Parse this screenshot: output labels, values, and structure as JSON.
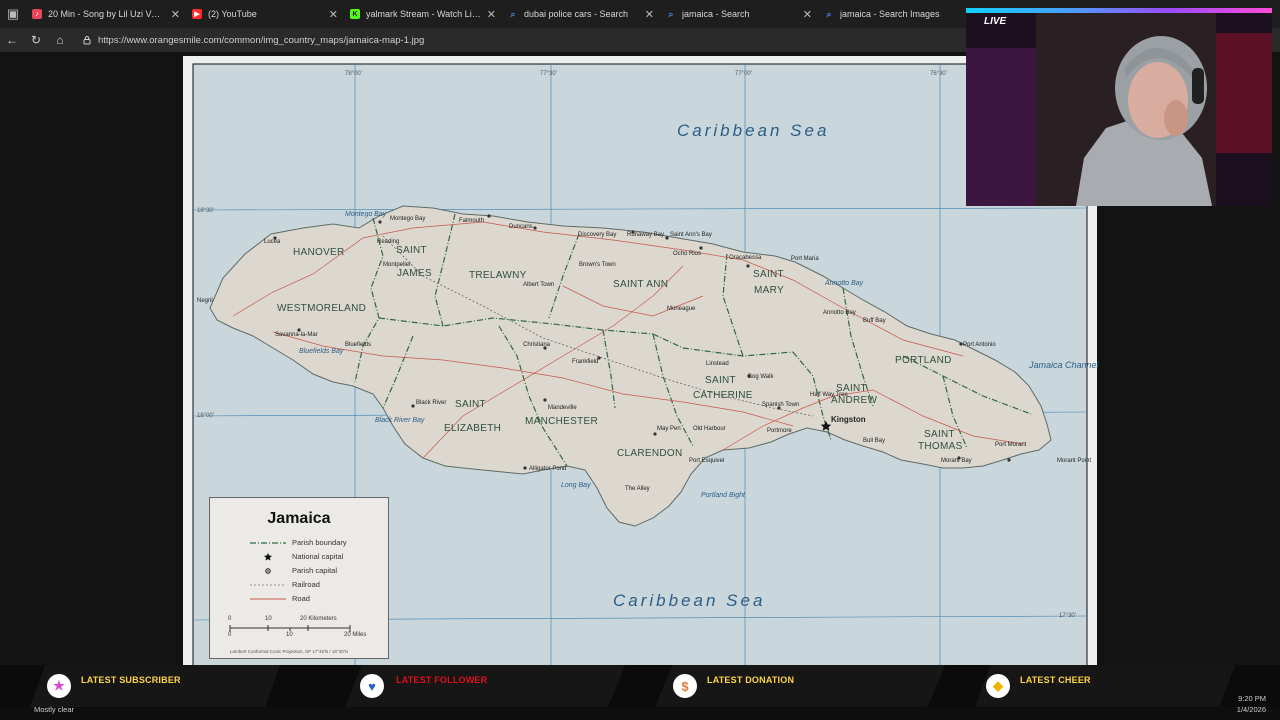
{
  "browser": {
    "tabs": [
      {
        "title": "20 Min - Song by Lil Uzi Vert - Ap",
        "favicon": "music-icon",
        "color": "#e8465a",
        "active": false
      },
      {
        "title": "(2) YouTube",
        "favicon": "youtube-icon",
        "color": "#ff2b2b",
        "active": false
      },
      {
        "title": "yalmark Stream - Watch Live on K",
        "favicon": "kick-icon",
        "color": "#53fc18",
        "active": false
      },
      {
        "title": "dubai police cars - Search",
        "favicon": "search-icon",
        "color": "#3b8de8",
        "active": false
      },
      {
        "title": "jamaica - Search",
        "favicon": "search-icon",
        "color": "#3b8de8",
        "active": false
      },
      {
        "title": "jamaica - Search Images",
        "favicon": "search-icon",
        "color": "#3b8de8",
        "active": false
      }
    ],
    "url": "https://www.orangesmile.com/common/img_country_maps/jamaica-map-1.jpg"
  },
  "map": {
    "seas": {
      "north": "Caribbean Sea",
      "south": "Caribbean Sea"
    },
    "parishes": [
      {
        "name": "HANOVER"
      },
      {
        "name": "SAINT"
      },
      {
        "name": "JAMES"
      },
      {
        "name": "TRELAWNY"
      },
      {
        "name": "SAINT ANN"
      },
      {
        "name": "SAINT"
      },
      {
        "name": "MARY"
      },
      {
        "name": "WESTMORELAND"
      },
      {
        "name": "PORTLAND"
      },
      {
        "name": "SAINT"
      },
      {
        "name": "ANDREW"
      },
      {
        "name": "SAINT"
      },
      {
        "name": "CATHERINE"
      },
      {
        "name": "SAINT"
      },
      {
        "name": "ELIZABETH"
      },
      {
        "name": "MANCHESTER"
      },
      {
        "name": "CLARENDON"
      },
      {
        "name": "SAINT"
      },
      {
        "name": "THOMAS"
      }
    ],
    "towns": [
      "Montego Bay",
      "Falmouth",
      "Duncans",
      "Discovery Bay",
      "Runaway Bay",
      "Saint Ann's Bay",
      "Ocho Rios",
      "Oracabessa",
      "Port Maria",
      "Lucea",
      "Reading",
      "Montpelier",
      "Albert Town",
      "Brown's Town",
      "Moneague",
      "Negril",
      "Savanna-la-Mar",
      "Bluefields",
      "Christiana",
      "Frankfield",
      "Linstead",
      "Bog Walk",
      "Annotto Bay",
      "Buff Bay",
      "Port Antonio",
      "Black River",
      "Mandeville",
      "Alligator Pond",
      "Spanish Town",
      "Portmore",
      "Kingston",
      "Half Way Tree",
      "May Pen",
      "Old Harbour",
      "Port Esquivel",
      "The Alley",
      "Bull Bay",
      "Port Morant",
      "Morant Bay",
      "Morant Point"
    ],
    "waters": [
      "Montego Bay",
      "Bluefields Bay",
      "Black River Bay",
      "Long Bay",
      "Portland Bight",
      "Annotto Bay",
      "Jamaica Channel"
    ],
    "coords": [
      "78°00'",
      "77°30'",
      "77°00'",
      "76°30'",
      "18°30'",
      "18°00'",
      "17°30'"
    ],
    "legend": {
      "title": "Jamaica",
      "items": [
        "Parish boundary",
        "National capital",
        "Parish capital",
        "Railroad",
        "Road"
      ],
      "scale_km": [
        "0",
        "10",
        "20 Kilometers"
      ],
      "scale_mi": [
        "0",
        "10",
        "20 Miles"
      ],
      "projection": "Lambert Conformal Conic Projection, SP 17°45'N / 18°30'N"
    }
  },
  "webcam": {
    "live_label": "LIVE"
  },
  "overlay": {
    "items": [
      {
        "label": "LATEST SUBSCRIBER",
        "icon": "star-icon",
        "icon_color": "#d64ad6"
      },
      {
        "label": "LATEST FOLLOWER",
        "icon": "heart-icon",
        "icon_color": "#2a5fd6"
      },
      {
        "label": "LATEST DONATION",
        "icon": "dollar-icon",
        "icon_color": "#e87a3a"
      },
      {
        "label": "LATEST CHEER",
        "icon": "diamond-icon",
        "icon_color": "#f0b400"
      }
    ],
    "weather": "Mostly clear",
    "time": "9:20 PM",
    "date": "1/4/2026"
  }
}
